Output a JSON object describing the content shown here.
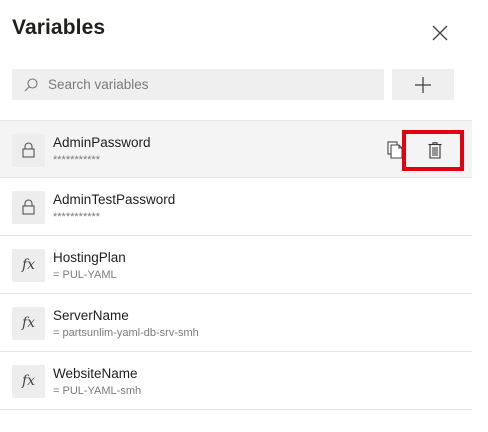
{
  "panel": {
    "title": "Variables",
    "close_label": "Close"
  },
  "search": {
    "placeholder": "Search variables",
    "value": ""
  },
  "add_button": {
    "label": "Add variable"
  },
  "variables": [
    {
      "name": "AdminPassword",
      "value": "***********",
      "type": "secret",
      "icon": "lock-icon"
    },
    {
      "name": "AdminTestPassword",
      "value": "***********",
      "type": "secret",
      "icon": "lock-icon"
    },
    {
      "name": "HostingPlan",
      "value": "= PUL-YAML",
      "type": "expression",
      "icon": "fx-icon"
    },
    {
      "name": "ServerName",
      "value": "= partsunlim-yaml-db-srv-smh",
      "type": "expression",
      "icon": "fx-icon"
    },
    {
      "name": "WebsiteName",
      "value": "= PUL-YAML-smh",
      "type": "expression",
      "icon": "fx-icon"
    }
  ],
  "fx_glyph": "fx",
  "colors": {
    "highlight_border": "#e3000f",
    "selected_row_bg": "#f4f4f4",
    "tile_bg": "#ededed"
  }
}
